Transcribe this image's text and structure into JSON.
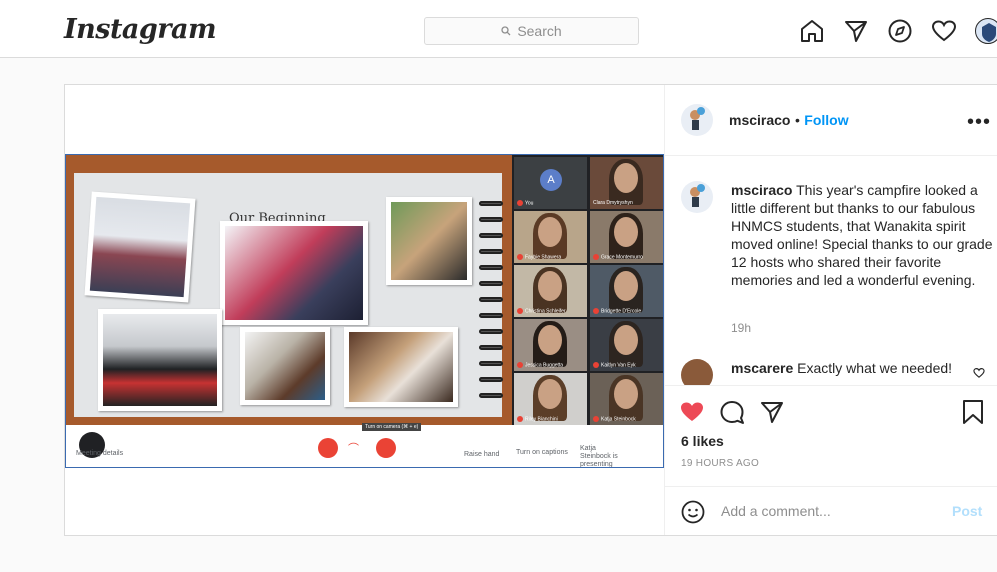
{
  "app": {
    "logo": "Instagram"
  },
  "search": {
    "placeholder": "Search"
  },
  "nav": {
    "icons": [
      "home-icon",
      "direct-icon",
      "explore-icon",
      "activity-icon",
      "profile-avatar"
    ]
  },
  "post": {
    "username": "msciraco",
    "follow_separator": "•",
    "follow_label": "Follow",
    "more_label": "•••",
    "caption_user": "msciraco",
    "caption_text": "This year's campfire looked a little different but thanks to our fabulous HNMCS students, that Wanakita spirit moved online! Special thanks to our grade 12 hosts who shared their favorite memories and led a wonderful evening.",
    "caption_time": "19h",
    "comment_user": "mscarere",
    "comment_text": "Exactly what we needed!",
    "likes": "6 likes",
    "time_ago": "19 HOURS AGO",
    "add_comment_placeholder": "Add a comment...",
    "post_label": "Post"
  },
  "image": {
    "book_title": "Our Beginning",
    "participants": [
      {
        "name": "You",
        "avatar_letter": "A"
      },
      {
        "name": "Clara Dmytryshyn"
      },
      {
        "name": "Faybie Shawera"
      },
      {
        "name": "Grace Montemurro"
      },
      {
        "name": "Christina Schleifer"
      },
      {
        "name": "Bridgette D'Ercole"
      },
      {
        "name": "Jessica Buggetta"
      },
      {
        "name": "Kaitlyn Van Eyk"
      },
      {
        "name": "Riley Bianchini"
      },
      {
        "name": "Katja Steinbock"
      }
    ],
    "meeting_details": "Meeting details",
    "turn_on_camera_tip": "Turn on camera (⌘ + e)",
    "raise_hand": "Raise hand",
    "turn_on_captions": "Turn on captions",
    "presenting": "Katja Steinbock is presenting"
  },
  "colors": {
    "accent": "#0095f6",
    "like": "#ed4956",
    "board": "#a65a2c",
    "meet_red": "#ea4335"
  }
}
